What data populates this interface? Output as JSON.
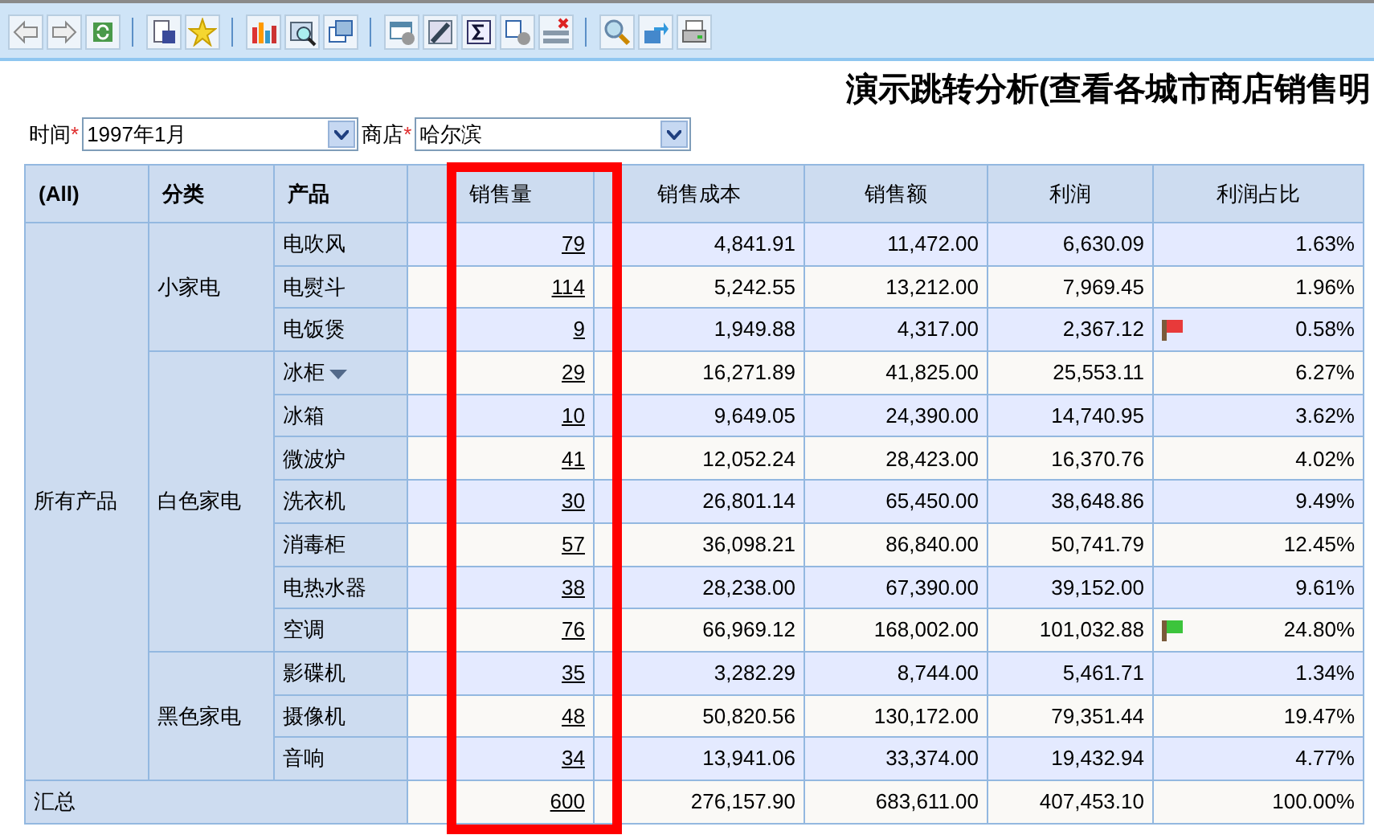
{
  "title": "演示跳转分析(查看各城市商店销售明",
  "filters": [
    {
      "label": "时间",
      "required_mark": "*",
      "value": "1997年1月"
    },
    {
      "label": "商店",
      "required_mark": "*",
      "value": "哈尔滨"
    }
  ],
  "table": {
    "corner": "(All)",
    "columns": [
      {
        "label": "分类",
        "highlighted": false
      },
      {
        "label": "产品",
        "highlighted": false
      },
      {
        "label": "销售量",
        "highlighted": true
      },
      {
        "label": "销售成本",
        "highlighted": false
      },
      {
        "label": "销售额",
        "highlighted": false
      },
      {
        "label": "利润",
        "highlighted": false
      },
      {
        "label": "利润占比",
        "highlighted": false
      }
    ],
    "groups": [
      {
        "label": "所有产品",
        "children": [
          {
            "label": "小家电",
            "children": [
              {
                "product": "电吹风",
                "dropdown": false,
                "values": [
                  "79",
                  "4,841.91",
                  "11,472.00",
                  "6,630.09",
                  "1.63%"
                ]
              },
              {
                "product": "电熨斗",
                "dropdown": false,
                "values": [
                  "114",
                  "5,242.55",
                  "13,212.00",
                  "7,969.45",
                  "1.96%"
                ]
              },
              {
                "product": "电饭煲",
                "dropdown": false,
                "color": "#e83a3a",
                "values": [
                  "9",
                  "1,949.88",
                  "4,317.00",
                  "2,367.12",
                  "0.58%"
                ]
              }
            ]
          },
          {
            "label": "白色家电",
            "children": [
              {
                "product": "冰柜",
                "dropdown": true,
                "values": [
                  "29",
                  "16,271.89",
                  "41,825.00",
                  "25,553.11",
                  "6.27%"
                ]
              },
              {
                "product": "冰箱",
                "dropdown": false,
                "values": [
                  "10",
                  "9,649.05",
                  "24,390.00",
                  "14,740.95",
                  "3.62%"
                ]
              },
              {
                "product": "微波炉",
                "dropdown": false,
                "values": [
                  "41",
                  "12,052.24",
                  "28,423.00",
                  "16,370.76",
                  "4.02%"
                ]
              },
              {
                "product": "洗衣机",
                "dropdown": false,
                "values": [
                  "30",
                  "26,801.14",
                  "65,450.00",
                  "38,648.86",
                  "9.49%"
                ]
              },
              {
                "product": "消毒柜",
                "dropdown": false,
                "values": [
                  "57",
                  "36,098.21",
                  "86,840.00",
                  "50,741.79",
                  "12.45%"
                ]
              },
              {
                "product": "电热水器",
                "dropdown": false,
                "values": [
                  "38",
                  "28,238.00",
                  "67,390.00",
                  "39,152.00",
                  "9.61%"
                ]
              },
              {
                "product": "空调",
                "dropdown": false,
                "color": "#3cc43c",
                "values": [
                  "76",
                  "66,969.12",
                  "168,002.00",
                  "101,032.88",
                  "24.80%"
                ]
              }
            ]
          },
          {
            "label": "黑色家电",
            "children": [
              {
                "product": "影碟机",
                "dropdown": false,
                "values": [
                  "35",
                  "3,282.29",
                  "8,744.00",
                  "5,461.71",
                  "1.34%"
                ]
              },
              {
                "product": "摄像机",
                "dropdown": false,
                "values": [
                  "48",
                  "50,820.56",
                  "130,172.00",
                  "79,351.44",
                  "19.47%"
                ]
              },
              {
                "product": "音响",
                "dropdown": false,
                "values": [
                  "34",
                  "13,941.06",
                  "33,374.00",
                  "19,432.94",
                  "4.77%"
                ]
              }
            ]
          }
        ]
      }
    ],
    "total": {
      "label": "汇总",
      "values": [
        "600",
        "276,157.90",
        "683,611.00",
        "407,453.10",
        "100.00%"
      ]
    }
  }
}
